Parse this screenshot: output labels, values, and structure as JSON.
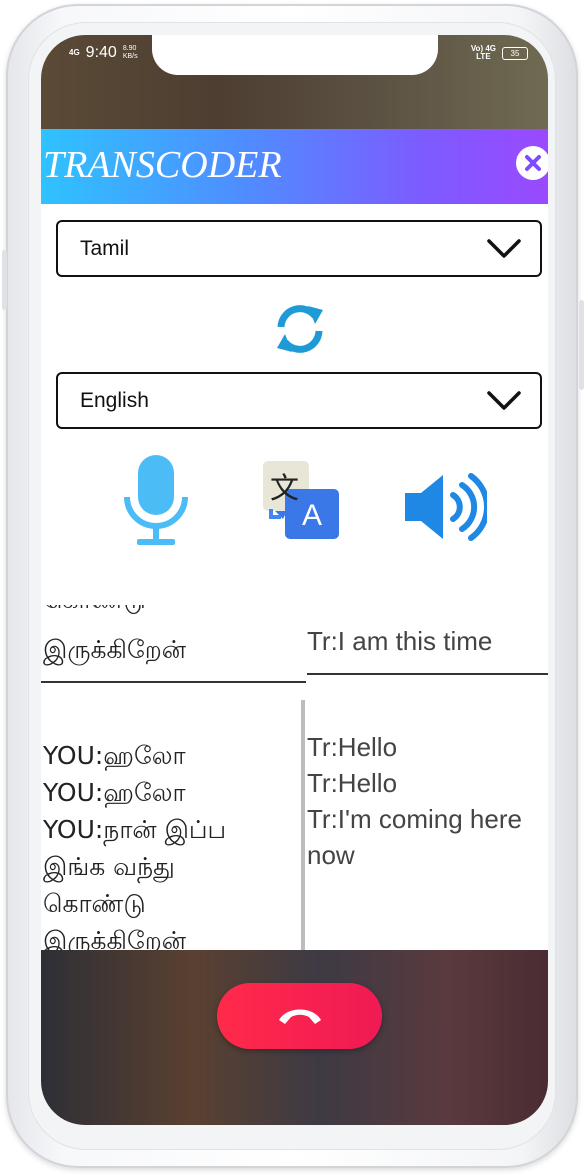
{
  "status_bar": {
    "network_left": "4G",
    "time": "9:40",
    "speed": "8.90",
    "speed_unit": "KB/s",
    "network_right_1": "Vo) 4G",
    "network_right_2": "LTE",
    "battery": "35"
  },
  "header": {
    "title": "TRANSCODER",
    "close_icon": "close-icon"
  },
  "source_language": {
    "selected": "Tamil",
    "icon": "chevron-down-icon"
  },
  "swap_icon": "swap-refresh-icon",
  "target_language": {
    "selected": "English",
    "icon": "chevron-down-icon"
  },
  "actions": {
    "microphone_icon": "microphone-icon",
    "translate_icon": "google-translate-icon",
    "translate_glyph_top": "文",
    "translate_glyph_bottom": "A",
    "speaker_icon": "speaker-icon"
  },
  "conversation": {
    "tamil_top_partial": "கொண்டு",
    "tamil_top": "இருக்கிறேன்",
    "tamil_lines": [
      "YOU:ஹலோ",
      "YOU:ஹலோ",
      "YOU:நான் இப்ப",
      "இங்க வந்து",
      "கொண்டு",
      "இருக்கிறேன்"
    ],
    "english_top": "Tr:I am this time",
    "english_lines": [
      "Tr:Hello",
      "Tr:Hello",
      "Tr:I'm coming here",
      "now"
    ]
  },
  "end_call_icon": "end-call-icon",
  "colors": {
    "title_gradient_start": "#2fc2ff",
    "title_gradient_end": "#9a49ff",
    "mic_blue": "#4bbcf5",
    "swap_blue": "#1e9bd7",
    "speaker_blue": "#1f88e5",
    "end_call_red": "#f71e4e"
  }
}
